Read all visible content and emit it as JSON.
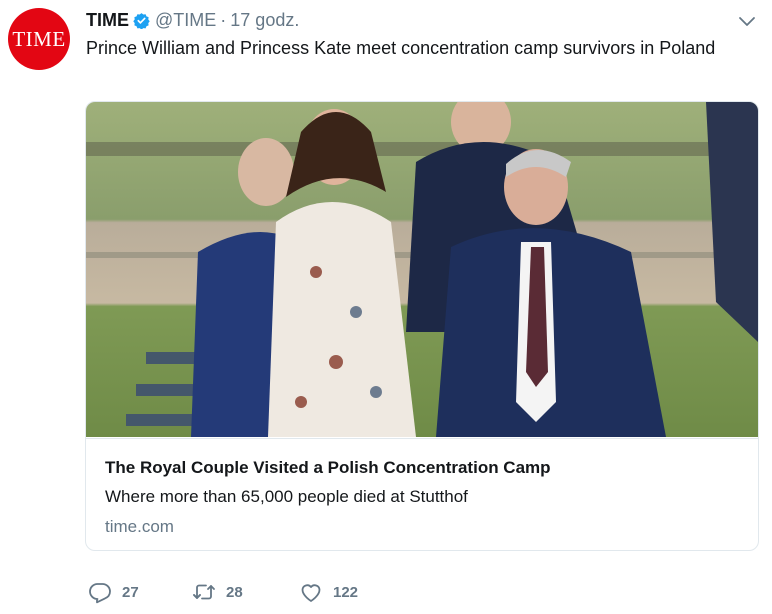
{
  "tweet": {
    "avatar_text": "TIME",
    "name": "TIME",
    "handle": "@TIME",
    "separator": "·",
    "time": "17 godz.",
    "text": "Prince William and Princess Kate meet concentration camp survivors in Poland",
    "verified_icon": "verified-badge-icon",
    "menu_icon": "chevron-down-icon"
  },
  "card": {
    "image_description_icon": "photo",
    "title": "The Royal Couple Visited a Polish Concentration Camp",
    "description": "Where more than 65,000 people died at Stutthof",
    "domain": "time.com"
  },
  "actions": {
    "reply_count": "27",
    "retweet_count": "28",
    "like_count": "122"
  },
  "colors": {
    "brand_red": "#e30613",
    "verified_blue": "#1da1f2",
    "secondary_text": "#657786",
    "border": "#e1e8ed"
  }
}
